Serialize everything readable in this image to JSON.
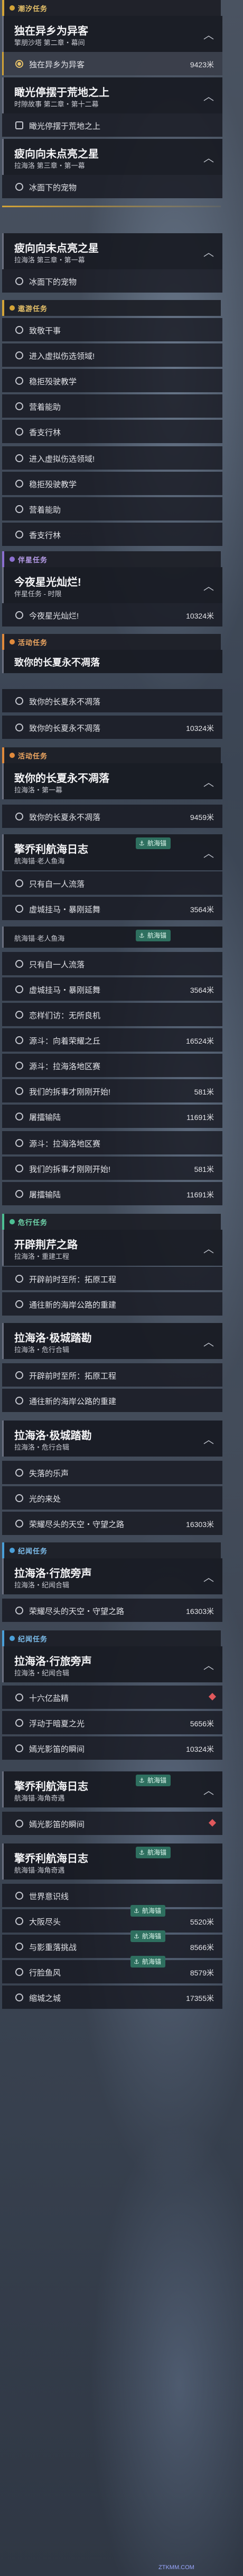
{
  "sections": [
    {
      "label": "潮汐任务"
    },
    {
      "label": "遨游任务"
    },
    {
      "label": "伴星任务"
    },
    {
      "label": "活动任务"
    },
    {
      "label": "活动任务"
    },
    {
      "label": "危行任务"
    },
    {
      "label": "纪闻任务"
    },
    {
      "label": "纪闻任务"
    }
  ],
  "cards": [
    {
      "title": "独在异乡为异客",
      "sub": "擎朋沙塔 第二章・幕间"
    },
    {
      "title": "瞰光停摆于荒地之上",
      "sub": "时隙故事 第二章・第十二幕"
    },
    {
      "title": "疲向向未点亮之星",
      "sub": "拉海洛 第三章・第一幕"
    },
    {
      "title": "疲向向未点亮之星",
      "sub": "拉海洛 第三章・第一幕"
    },
    {
      "title": "今夜星光灿烂!",
      "sub": "伴星任务 - 时限"
    },
    {
      "title": "致你的长夏永不凋落",
      "sub": ""
    },
    {
      "title": "致你的长夏永不凋落",
      "sub": "拉海洛・第一幕"
    },
    {
      "title": "擎乔利航海日志",
      "sub": "航海锚·老人鱼海"
    },
    {
      "title": "开辟荆芹之路",
      "sub": "拉海洛・重建工程"
    },
    {
      "title": "拉海洛·极城踏勘",
      "sub": "拉海洛・危行合辑"
    },
    {
      "title": "拉海洛·极城踏勘",
      "sub": "拉海洛・危行合辑"
    },
    {
      "title": "拉海洛·行旅旁声",
      "sub": "拉海洛・纪闻合辑"
    },
    {
      "title": "拉海洛·行旅旁声",
      "sub": "拉海洛・纪闻合辑"
    },
    {
      "title": "擎乔利航海日志",
      "sub": "航海锚·海角奇遇"
    },
    {
      "title": "擎乔利航海日志",
      "sub": "航海锚·海角奇遇"
    }
  ],
  "rows": [
    {
      "label": "独在异乡为异客",
      "dist": "9423米"
    },
    {
      "label": "瞰光停摆于荒地之上",
      "dist": ""
    },
    {
      "label": "冰面下的宠物",
      "dist": ""
    },
    {
      "label": "冰面下的宠物",
      "dist": ""
    },
    {
      "label": "致敬干事",
      "dist": ""
    },
    {
      "label": "进入虚拟伤选领域!",
      "dist": ""
    },
    {
      "label": "稳拒殁驶教学",
      "dist": ""
    },
    {
      "label": "营着能助",
      "dist": ""
    },
    {
      "label": "香支行林",
      "dist": ""
    },
    {
      "label": "进入虚拟伤选领域!",
      "dist": ""
    },
    {
      "label": "稳拒殁驶教学",
      "dist": ""
    },
    {
      "label": "营着能助",
      "dist": ""
    },
    {
      "label": "香支行林",
      "dist": ""
    },
    {
      "label": "今夜星光灿烂!",
      "dist": "10324米"
    },
    {
      "label": "致你的长夏永不凋落",
      "dist": ""
    },
    {
      "label": "致你的长夏永不凋落",
      "dist": "10324米"
    },
    {
      "label": "致你的长夏永不凋落",
      "dist": "9459米"
    },
    {
      "label": "只有自一人流落",
      "dist": ""
    },
    {
      "label": "虚城挂马・暴刚延舞",
      "dist": "3564米"
    },
    {
      "label": "只有自一人流落",
      "dist": ""
    },
    {
      "label": "虚城挂马・暴刚延舞",
      "dist": "3564米"
    },
    {
      "label": "恋样们访：无所良机",
      "dist": ""
    },
    {
      "label": "源斗：向着荣耀之丘",
      "dist": "16524米"
    },
    {
      "label": "源斗：拉海洛地区赛",
      "dist": ""
    },
    {
      "label": "我们的拆事才刚刚开始!",
      "dist": "581米"
    },
    {
      "label": "屠擂输陆",
      "dist": "11691米"
    },
    {
      "label": "源斗：拉海洛地区赛",
      "dist": ""
    },
    {
      "label": "我们的拆事才刚刚开始!",
      "dist": "581米"
    },
    {
      "label": "屠擂输陆",
      "dist": "11691米"
    },
    {
      "label": "开辟前时至所：拓原工程",
      "dist": ""
    },
    {
      "label": "通往新的海岸公路的重建",
      "dist": ""
    },
    {
      "label": "开辟前时至所：拓原工程",
      "dist": ""
    },
    {
      "label": "通往新的海岸公路的重建",
      "dist": ""
    },
    {
      "label": "失落的乐声",
      "dist": ""
    },
    {
      "label": "光的来处",
      "dist": ""
    },
    {
      "label": "荣耀尽头的天空・守望之路",
      "dist": "16303米"
    },
    {
      "label": "荣耀尽头的天空・守望之路",
      "dist": "16303米"
    },
    {
      "label": "十六亿盐精",
      "dist": ""
    },
    {
      "label": "浮动于暗夏之光",
      "dist": "5656米"
    },
    {
      "label": "嫣光影笛的瞬间",
      "dist": "10324米"
    },
    {
      "label": "嫣光影笛的瞬间",
      "dist": ""
    },
    {
      "label": "世界意识线",
      "dist": ""
    },
    {
      "label": "大阪尽头",
      "dist": "5520米"
    },
    {
      "label": "与影重落挑战",
      "dist": "8566米"
    },
    {
      "label": "行脸鱼风",
      "dist": "8579米"
    },
    {
      "label": "缩城之城",
      "dist": "17355米"
    }
  ],
  "tags": [
    {
      "label": "航海锚"
    },
    {
      "label": "航海锚"
    },
    {
      "label": "航海锚"
    },
    {
      "label": "航海锚"
    },
    {
      "label": "航海锚"
    },
    {
      "label": "航海锚"
    },
    {
      "label": "航海锚"
    }
  ],
  "watermark": "ZTKMM.COM"
}
